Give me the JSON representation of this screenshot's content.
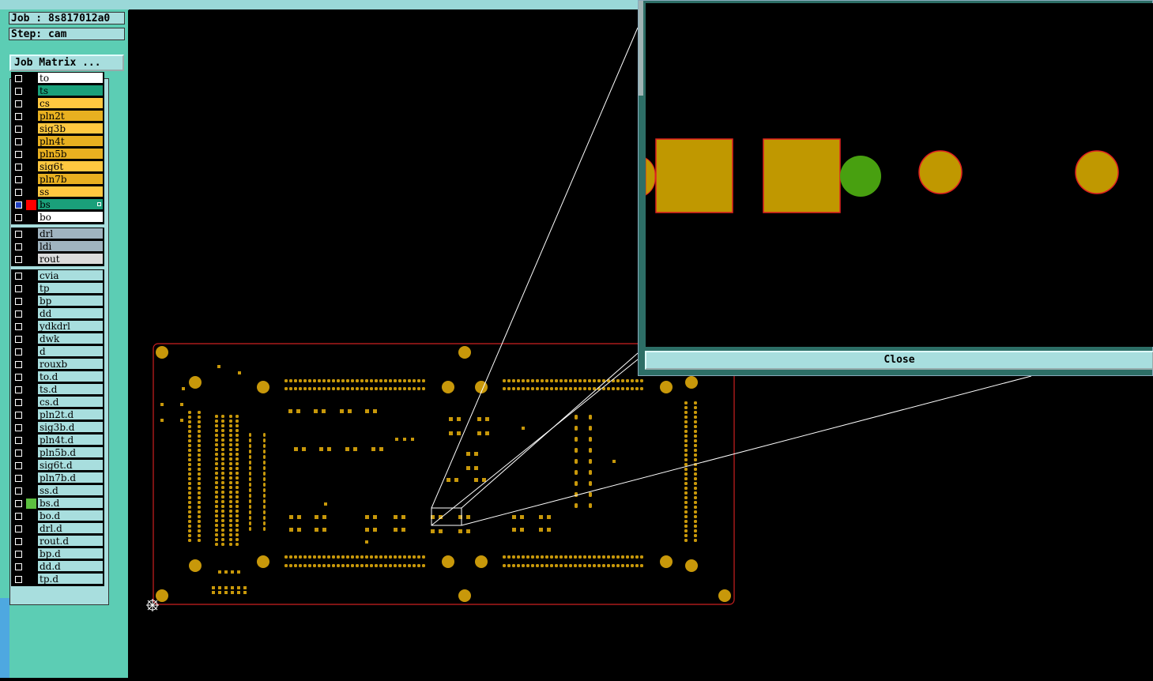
{
  "info": {
    "job": "Job : 8s817012a0",
    "step": "Step: cam"
  },
  "job_matrix_button": "Job Matrix ...",
  "close_button": "Close",
  "layer_groups": [
    {
      "layers": [
        {
          "name": "to",
          "color": "#ffffff",
          "swatch": "#000000",
          "checked": false
        },
        {
          "name": "ts",
          "color": "#1aa07a",
          "swatch": "#000000",
          "checked": false
        },
        {
          "name": "cs",
          "color": "#ffc840",
          "swatch": "#000000",
          "checked": false
        },
        {
          "name": "pln2t",
          "color": "#e8b020",
          "swatch": "#000000",
          "checked": false
        },
        {
          "name": "sig3b",
          "color": "#ffc840",
          "swatch": "#000000",
          "checked": false
        },
        {
          "name": "pln4t",
          "color": "#e8b020",
          "swatch": "#000000",
          "checked": false
        },
        {
          "name": "pln5b",
          "color": "#e8b020",
          "swatch": "#000000",
          "checked": false
        },
        {
          "name": "sig6t",
          "color": "#ffc840",
          "swatch": "#000000",
          "checked": false
        },
        {
          "name": "pln7b",
          "color": "#e8b020",
          "swatch": "#000000",
          "checked": false
        },
        {
          "name": "ss",
          "color": "#ffc840",
          "swatch": "#000000",
          "checked": false
        },
        {
          "name": "bs",
          "color": "#1aa07a",
          "swatch": "#ff0000",
          "checked": true
        },
        {
          "name": "bo",
          "color": "#ffffff",
          "swatch": "#000000",
          "checked": false
        }
      ]
    },
    {
      "layers": [
        {
          "name": "drl",
          "color": "#a0b4c0",
          "swatch": "#000000",
          "checked": false
        },
        {
          "name": "ldi",
          "color": "#a0b4c0",
          "swatch": "#000000",
          "checked": false
        },
        {
          "name": "rout",
          "color": "#dcdcdc",
          "swatch": "#000000",
          "checked": false
        }
      ]
    },
    {
      "layers": [
        {
          "name": "cvia",
          "color": "#a8dede",
          "swatch": "#000000",
          "checked": false
        },
        {
          "name": "tp",
          "color": "#a8dede",
          "swatch": "#000000",
          "checked": false
        },
        {
          "name": "bp",
          "color": "#a8dede",
          "swatch": "#000000",
          "checked": false
        },
        {
          "name": "dd",
          "color": "#a8dede",
          "swatch": "#000000",
          "checked": false
        },
        {
          "name": "ydkdrl",
          "color": "#a8dede",
          "swatch": "#000000",
          "checked": false
        },
        {
          "name": "dwk",
          "color": "#a8dede",
          "swatch": "#000000",
          "checked": false
        },
        {
          "name": "d",
          "color": "#a8dede",
          "swatch": "#000000",
          "checked": false
        },
        {
          "name": "rouxb",
          "color": "#a8dede",
          "swatch": "#000000",
          "checked": false
        },
        {
          "name": "to.d",
          "color": "#a8dede",
          "swatch": "#000000",
          "checked": false
        },
        {
          "name": "ts.d",
          "color": "#a8dede",
          "swatch": "#000000",
          "checked": false
        },
        {
          "name": "cs.d",
          "color": "#a8dede",
          "swatch": "#000000",
          "checked": false
        },
        {
          "name": "pln2t.d",
          "color": "#a8dede",
          "swatch": "#000000",
          "checked": false
        },
        {
          "name": "sig3b.d",
          "color": "#a8dede",
          "swatch": "#000000",
          "checked": false
        },
        {
          "name": "pln4t.d",
          "color": "#a8dede",
          "swatch": "#000000",
          "checked": false
        },
        {
          "name": "pln5b.d",
          "color": "#a8dede",
          "swatch": "#000000",
          "checked": false
        },
        {
          "name": "sig6t.d",
          "color": "#a8dede",
          "swatch": "#000000",
          "checked": false
        },
        {
          "name": "pln7b.d",
          "color": "#a8dede",
          "swatch": "#000000",
          "checked": false
        },
        {
          "name": "ss.d",
          "color": "#a8dede",
          "swatch": "#000000",
          "checked": false
        },
        {
          "name": "bs.d",
          "color": "#a8dede",
          "swatch": "#5cc040",
          "checked": false
        },
        {
          "name": "bo.d",
          "color": "#a8dede",
          "swatch": "#000000",
          "checked": false
        },
        {
          "name": "drl.d",
          "color": "#a8dede",
          "swatch": "#000000",
          "checked": false
        },
        {
          "name": "rout.d",
          "color": "#a8dede",
          "swatch": "#000000",
          "checked": false
        },
        {
          "name": "bp.d",
          "color": "#a8dede",
          "swatch": "#000000",
          "checked": false
        },
        {
          "name": "dd.d",
          "color": "#a8dede",
          "swatch": "#000000",
          "checked": false
        },
        {
          "name": "tp.d",
          "color": "#a8dede",
          "swatch": "#000000",
          "checked": false
        }
      ]
    }
  ],
  "colors": {
    "pad": "#c8980a",
    "board_outline": "#cc2020",
    "zoom_pad": "#c09800",
    "zoom_pad_green": "#48a010",
    "zoom_outline": "#e02020"
  }
}
